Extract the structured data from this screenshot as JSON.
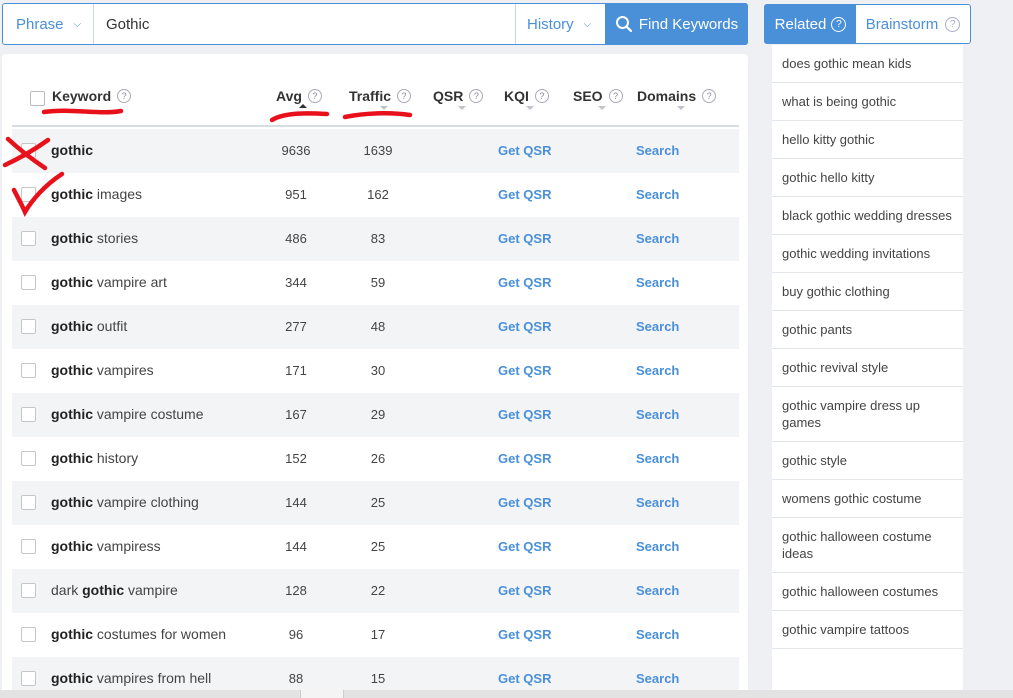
{
  "search": {
    "mode_label": "Phrase",
    "query_value": "Gothic",
    "history_label": "History",
    "find_label": "Find Keywords"
  },
  "table": {
    "headers": {
      "keyword": "Keyword",
      "avg": "Avg",
      "traffic": "Traffic",
      "qsr": "QSR",
      "kqi": "KQI",
      "seo": "SEO",
      "domains": "Domains"
    },
    "rows": [
      {
        "pre": "",
        "bold": "gothic",
        "post": "",
        "avg": "9636",
        "traffic": "1639",
        "qsr": "Get QSR",
        "domains": "Search"
      },
      {
        "pre": "",
        "bold": "gothic",
        "post": " images",
        "avg": "951",
        "traffic": "162",
        "qsr": "Get QSR",
        "domains": "Search"
      },
      {
        "pre": "",
        "bold": "gothic",
        "post": " stories",
        "avg": "486",
        "traffic": "83",
        "qsr": "Get QSR",
        "domains": "Search"
      },
      {
        "pre": "",
        "bold": "gothic",
        "post": " vampire art",
        "avg": "344",
        "traffic": "59",
        "qsr": "Get QSR",
        "domains": "Search"
      },
      {
        "pre": "",
        "bold": "gothic",
        "post": " outfit",
        "avg": "277",
        "traffic": "48",
        "qsr": "Get QSR",
        "domains": "Search"
      },
      {
        "pre": "",
        "bold": "gothic",
        "post": " vampires",
        "avg": "171",
        "traffic": "30",
        "qsr": "Get QSR",
        "domains": "Search"
      },
      {
        "pre": "",
        "bold": "gothic",
        "post": " vampire costume",
        "avg": "167",
        "traffic": "29",
        "qsr": "Get QSR",
        "domains": "Search"
      },
      {
        "pre": "",
        "bold": "gothic",
        "post": " history",
        "avg": "152",
        "traffic": "26",
        "qsr": "Get QSR",
        "domains": "Search"
      },
      {
        "pre": "",
        "bold": "gothic",
        "post": " vampire clothing",
        "avg": "144",
        "traffic": "25",
        "qsr": "Get QSR",
        "domains": "Search"
      },
      {
        "pre": "",
        "bold": "gothic",
        "post": " vampiress",
        "avg": "144",
        "traffic": "25",
        "qsr": "Get QSR",
        "domains": "Search"
      },
      {
        "pre": "dark ",
        "bold": "gothic",
        "post": " vampire",
        "avg": "128",
        "traffic": "22",
        "qsr": "Get QSR",
        "domains": "Search"
      },
      {
        "pre": "",
        "bold": "gothic",
        "post": " costumes for women",
        "avg": "96",
        "traffic": "17",
        "qsr": "Get QSR",
        "domains": "Search"
      },
      {
        "pre": "",
        "bold": "gothic",
        "post": " vampires from hell",
        "avg": "88",
        "traffic": "15",
        "qsr": "Get QSR",
        "domains": "Search"
      }
    ]
  },
  "related": {
    "tab_related": "Related",
    "tab_brainstorm": "Brainstorm",
    "items": [
      "does gothic mean kids",
      "what is being gothic",
      "hello kitty gothic",
      "gothic hello kitty",
      "black gothic wedding dresses",
      "gothic wedding invitations",
      "buy gothic clothing",
      "gothic pants",
      "gothic revival style",
      "gothic vampire dress up games",
      "gothic style",
      "womens gothic costume",
      "gothic halloween costume ideas",
      "gothic halloween costumes",
      "gothic vampire tattoos"
    ]
  },
  "colors": {
    "accent": "#4a90d9",
    "annotation": "#e8101a"
  }
}
